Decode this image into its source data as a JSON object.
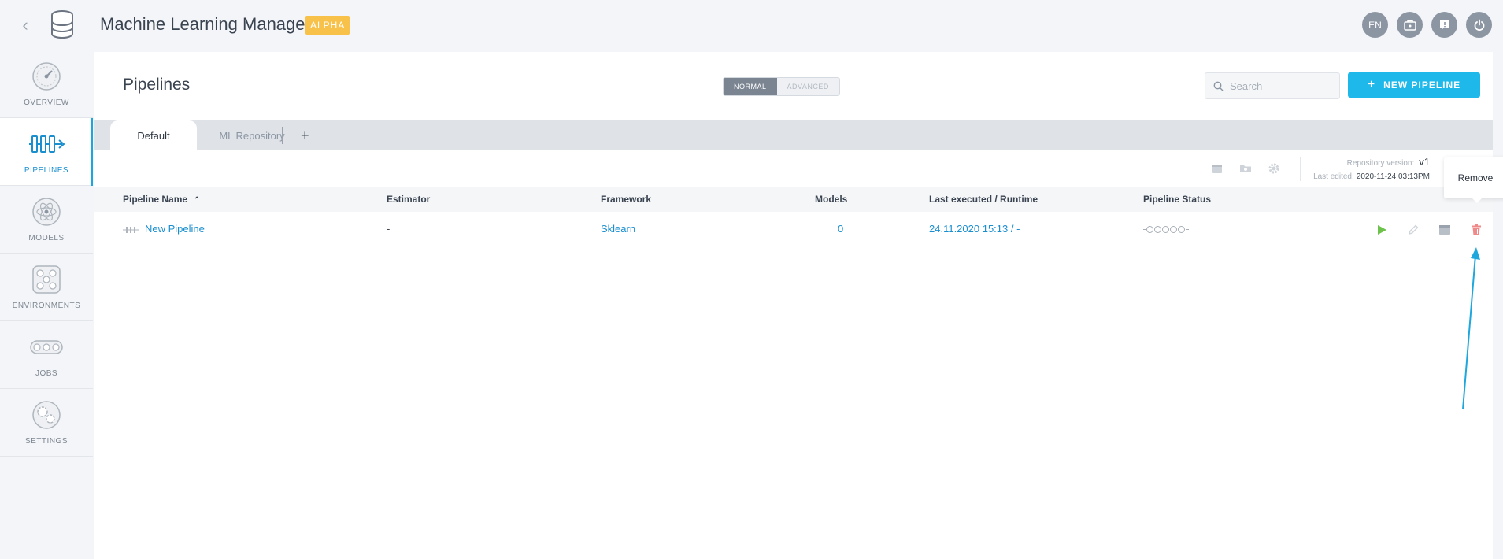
{
  "header": {
    "app_title": "Machine Learning Manager",
    "badge": "ALPHA",
    "language": "EN"
  },
  "sidebar": {
    "items": [
      {
        "label": "OVERVIEW",
        "icon": "gauge-icon",
        "active": false
      },
      {
        "label": "PIPELINES",
        "icon": "pipeline-icon",
        "active": true
      },
      {
        "label": "MODELS",
        "icon": "atom-icon",
        "active": false
      },
      {
        "label": "ENVIRONMENTS",
        "icon": "network-icon",
        "active": false
      },
      {
        "label": "JOBS",
        "icon": "conveyor-icon",
        "active": false
      },
      {
        "label": "SETTINGS",
        "icon": "gears-icon",
        "active": false
      }
    ]
  },
  "page": {
    "title": "Pipelines",
    "mode_normal": "NORMAL",
    "mode_advanced": "ADVANCED",
    "search_placeholder": "Search",
    "new_pipeline_label": "NEW PIPELINE",
    "new_pipeline_plus": "+"
  },
  "tabs": {
    "items": [
      "Default",
      "ML Repository"
    ],
    "add": "+"
  },
  "repository": {
    "version_label": "Repository version:",
    "version": "v1",
    "last_edited_label": "Last edited:",
    "last_edited": "2020-11-24 03:13PM"
  },
  "table": {
    "columns": [
      "Pipeline Name",
      "Estimator",
      "Framework",
      "Models",
      "Last executed / Runtime",
      "Pipeline Status"
    ],
    "rows": [
      {
        "name": "New Pipeline",
        "estimator": "-",
        "framework": "Sklearn",
        "models": "0",
        "last_executed": "24.11.2020 15:13 / -"
      }
    ]
  },
  "tooltip": {
    "text": "Remove"
  },
  "colors": {
    "accent": "#1fb8ea",
    "link": "#1a8fd0",
    "badge": "#f7c14a",
    "play": "#6cc24a",
    "delete": "#f08a8a",
    "annotation_arrow": "#1ea7dd"
  }
}
